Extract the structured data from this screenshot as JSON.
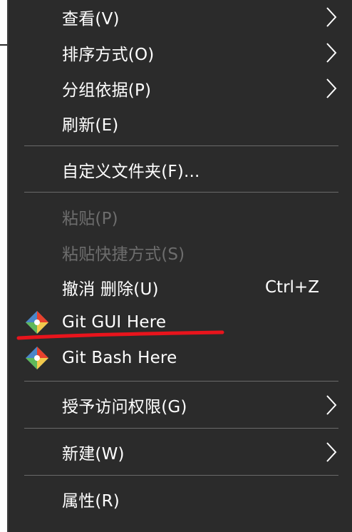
{
  "menu": {
    "items": [
      {
        "label": "查看(V)"
      },
      {
        "label": "排序方式(O)"
      },
      {
        "label": "分组依据(P)"
      },
      {
        "label": "刷新(E)"
      },
      {
        "label": "自定义文件夹(F)..."
      },
      {
        "label": "粘贴(P)"
      },
      {
        "label": "粘贴快捷方式(S)"
      },
      {
        "label": "撤消 删除(U)",
        "shortcut": "Ctrl+Z"
      },
      {
        "label": "Git GUI Here"
      },
      {
        "label": "Git Bash Here"
      },
      {
        "label": "授予访问权限(G)"
      },
      {
        "label": "新建(W)"
      },
      {
        "label": "属性(R)"
      }
    ]
  },
  "colors": {
    "menu_background": "#2b2b2b",
    "text": "#ffffff",
    "disabled_text": "#6d6d6d",
    "separator": "#6a6a6a",
    "annotation_red": "#e8141c"
  },
  "icons": {
    "submenu": "chevron-right-icon",
    "git": "git-logo-icon"
  }
}
